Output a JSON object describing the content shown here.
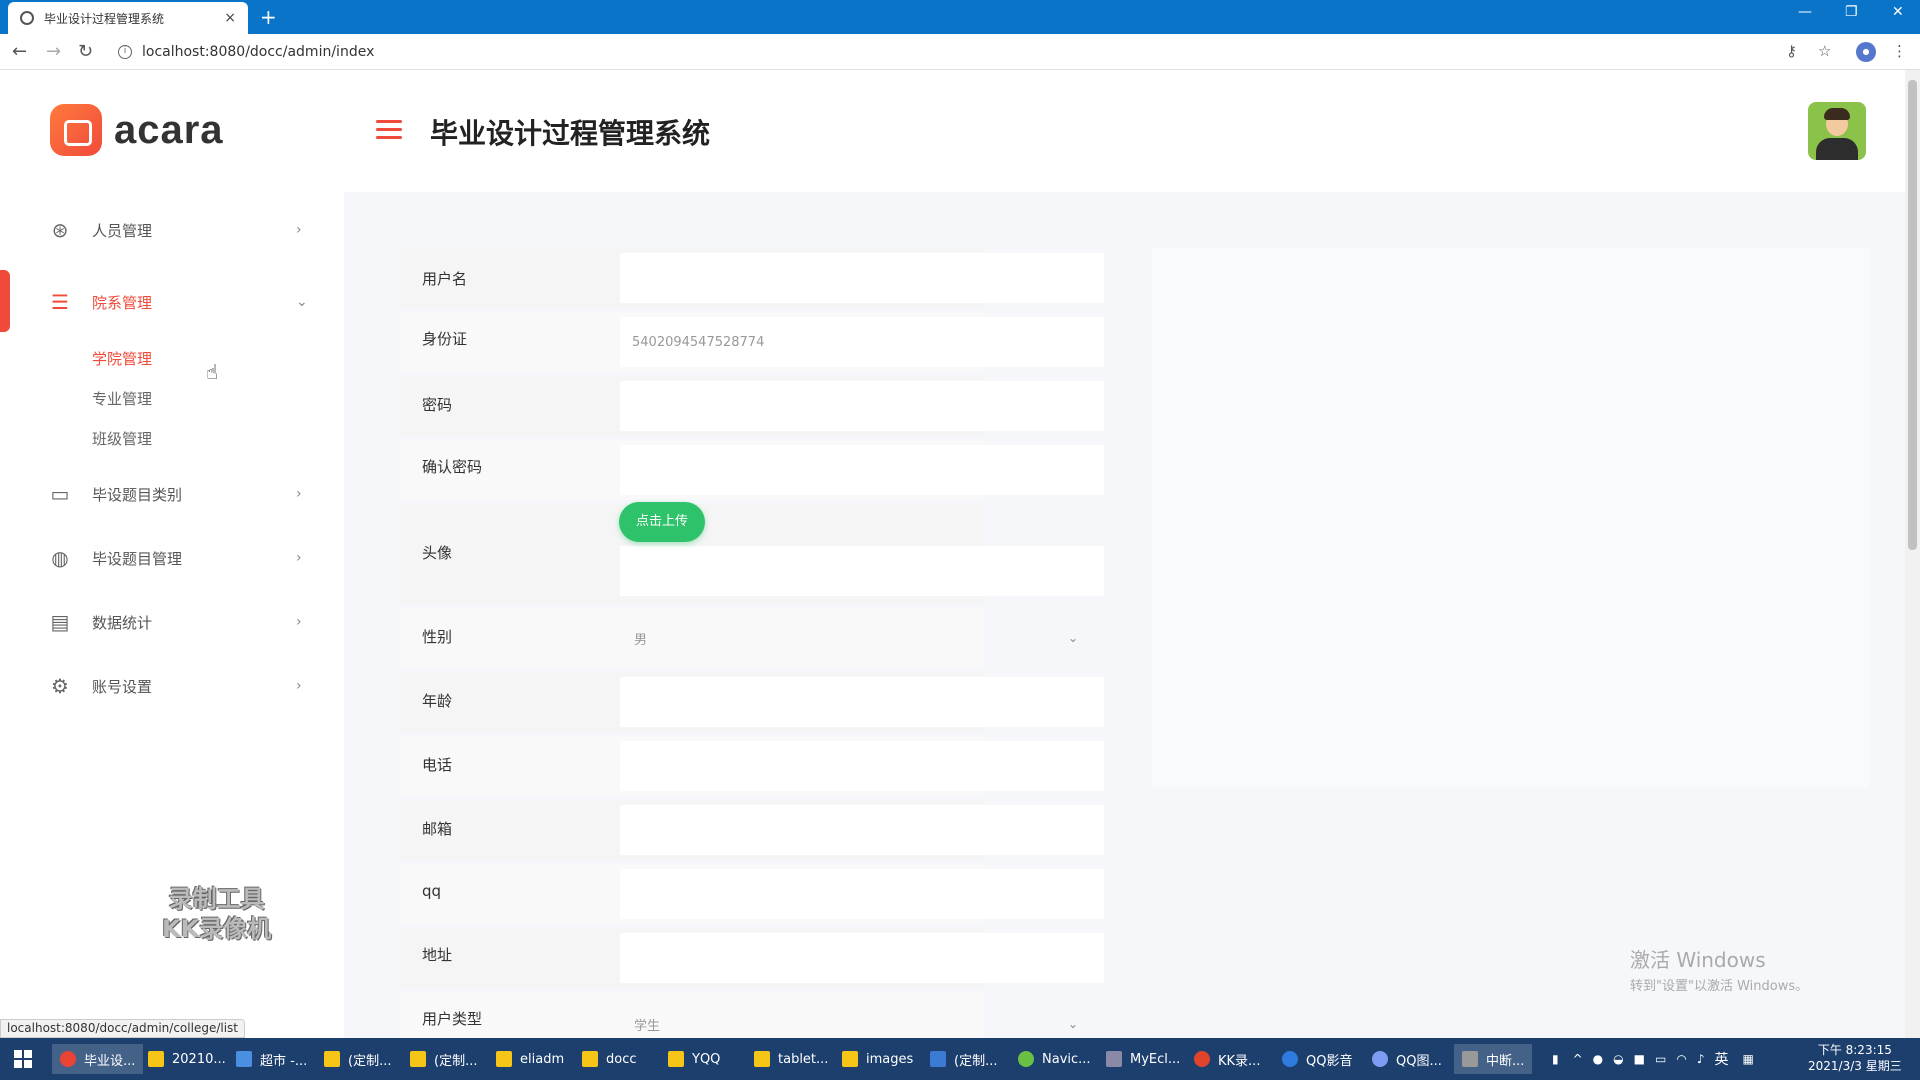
{
  "browser": {
    "tab_title": "毕业设计过程管理系统",
    "tab_close": "×",
    "new_tab": "+",
    "url": "localhost:8080/docc/admin/index",
    "status_url": "localhost:8080/docc/admin/college/list"
  },
  "app": {
    "logo_text": "acara",
    "title": "毕业设计过程管理系统"
  },
  "sidebar": {
    "items": [
      {
        "label": "人员管理",
        "icon": "users-icon"
      },
      {
        "label": "院系管理",
        "icon": "sliders-icon"
      },
      {
        "label": "毕设题目类别",
        "icon": "monitor-icon"
      },
      {
        "label": "毕设题目管理",
        "icon": "globe-icon"
      },
      {
        "label": "数据统计",
        "icon": "document-icon"
      },
      {
        "label": "账号设置",
        "icon": "gear-icon"
      }
    ],
    "sub_items": [
      "学院管理",
      "专业管理",
      "班级管理"
    ]
  },
  "watermark": {
    "line1": "录制工具",
    "line2": "KK录像机"
  },
  "form": {
    "labels": [
      "用户名",
      "身份证",
      "密码",
      "确认密码",
      "头像",
      "性别",
      "年龄",
      "电话",
      "邮箱",
      "qq",
      "地址",
      "用户类型"
    ],
    "id_card_value": "5402094547528774",
    "gender_value": "男",
    "user_type_value": "学生",
    "upload_label": "点击上传"
  },
  "activation": {
    "title": "激活 Windows",
    "subtitle": "转到\"设置\"以激活 Windows。"
  },
  "taskbar": {
    "items": [
      "毕业设...",
      "20210...",
      "超市 -...",
      "(定制...",
      "(定制...",
      "eliadm",
      "docc",
      "YQQ",
      "tablet...",
      "images",
      "(定制...",
      "Navic...",
      "MyEcl...",
      "KK录...",
      "QQ影音",
      "QQ图...",
      "中断..."
    ],
    "ime": "英",
    "time": "下午 8:23:15",
    "date": "2021/3/3 星期三"
  },
  "colors": {
    "accent": "#f04a3a",
    "upload": "#2ec26a",
    "taskbar": "#1c3f6e",
    "tabbar": "#0a74c8"
  }
}
